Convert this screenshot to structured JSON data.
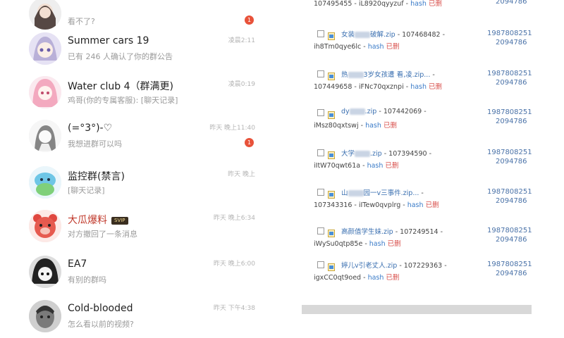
{
  "chats": [
    {
      "name": "",
      "msg": "看不了?",
      "time": "",
      "badge": "1",
      "avatar": "girl-dark"
    },
    {
      "name": "Summer cars 19",
      "msg": "已有 246 人确认了你的群公告",
      "time": "凌晨2:11",
      "badge": "",
      "avatar": "anime-purple"
    },
    {
      "name": "Water club 4（群满更)",
      "msg": "鸡哥(你的专属客服): [聊天记录]",
      "time": "凌晨0:19",
      "badge": "",
      "avatar": "anime-pink"
    },
    {
      "name": "(=°3°)-♡",
      "msg": "我想进群可以吗",
      "time": "昨天 晚上11:40",
      "badge": "1",
      "avatar": "anime-sketch"
    },
    {
      "name": "监控群(禁言)",
      "msg": "[聊天记录]",
      "time": "昨天 晚上",
      "badge": "",
      "avatar": "cartoon-blue"
    },
    {
      "name": "大瓜爆料",
      "msg": "对方撤回了一条消息",
      "time": "昨天 晚上6:34",
      "badge": "",
      "avatar": "bear-red",
      "vip": "SVIP"
    },
    {
      "name": "EA7",
      "msg": "有别的群吗",
      "time": "昨天 晚上6:00",
      "badge": "",
      "avatar": "anime-bw"
    },
    {
      "name": "Cold-blooded",
      "msg": "怎么看以前的视频?",
      "time": "昨天 下午4:38",
      "badge": "",
      "avatar": "man-bw"
    }
  ],
  "files": [
    {
      "name": "",
      "id": "",
      "code": "107495455 - iL8920qyyzuf",
      "hash": "hash",
      "status": "已删",
      "owner": "",
      "size": "2094786"
    },
    {
      "name": "女装",
      "id": "107468482",
      "code": "ih8Tm0qye6lc",
      "hash": "hash",
      "status": "已删",
      "owner": "1987808251",
      "size": "2094786",
      "suffix": "破解.zip"
    },
    {
      "name": "热",
      "id": "",
      "code": "107449658 - iFNc70qxznpi",
      "hash": "hash",
      "status": "已删",
      "owner": "1987808251",
      "size": "2094786",
      "suffix": "3岁女孩遭 看,凌.zip..."
    },
    {
      "name": "dy",
      "id": "107442069",
      "code": "iMsz80qxtswj",
      "hash": "hash",
      "status": "已删",
      "owner": "1987808251",
      "size": "2094786",
      "suffix": ".zip"
    },
    {
      "name": "大学",
      "id": "107394590",
      "code": "iItW70qwt61a",
      "hash": "hash",
      "status": "已删",
      "owner": "1987808251",
      "size": "2094786",
      "suffix": ".zip"
    },
    {
      "name": "山",
      "id": "",
      "code": "107343316 - iITew0qvplrg",
      "hash": "hash",
      "status": "已删",
      "owner": "1987808251",
      "size": "2094786",
      "suffix": "园一v三事件.zip..."
    },
    {
      "name": "高颜值学生妹.zip",
      "id": "107249514",
      "code": "iWySu0qtp85e",
      "hash": "hash",
      "status": "已删",
      "owner": "1987808251",
      "size": "2094786",
      "suffix": ""
    },
    {
      "name": "婷儿v引老丈人.zip",
      "id": "107229363",
      "code": "igxCC0qt9oed",
      "hash": "hash",
      "status": "已删",
      "owner": "1987808251",
      "size": "2094786",
      "suffix": ""
    }
  ],
  "colors": {
    "badge": "#e8523a",
    "link": "#3a7bc8",
    "deleted": "#d9534f"
  }
}
